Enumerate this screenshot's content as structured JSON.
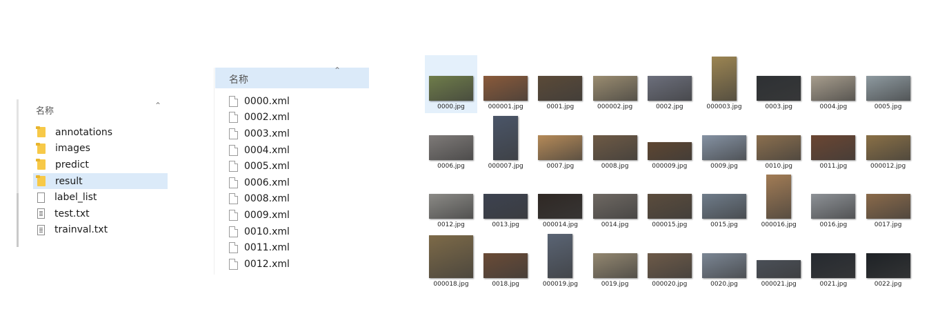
{
  "panel1": {
    "column_header": "名称",
    "items": [
      {
        "type": "folder",
        "label": "annotations"
      },
      {
        "type": "folder",
        "label": "images"
      },
      {
        "type": "folder",
        "label": "predict"
      },
      {
        "type": "folder",
        "label": "result",
        "selected": true
      },
      {
        "type": "file",
        "label": "label_list"
      },
      {
        "type": "txt",
        "label": "test.txt"
      },
      {
        "type": "txt",
        "label": "trainval.txt"
      }
    ]
  },
  "panel2": {
    "column_header": "名称",
    "files": [
      "0000.xml",
      "0002.xml",
      "0003.xml",
      "0004.xml",
      "0005.xml",
      "0006.xml",
      "0008.xml",
      "0009.xml",
      "0010.xml",
      "0011.xml",
      "0012.xml"
    ]
  },
  "panel3": {
    "thumbnails": [
      {
        "name": "0000.jpg",
        "orient": "land",
        "color": "#6f7d4a",
        "selected": true
      },
      {
        "name": "000001.jpg",
        "orient": "land",
        "color": "#8a5a3a"
      },
      {
        "name": "0001.jpg",
        "orient": "land",
        "color": "#5b4a38"
      },
      {
        "name": "000002.jpg",
        "orient": "land",
        "color": "#9a8c70"
      },
      {
        "name": "0002.jpg",
        "orient": "land",
        "color": "#6c6f7c"
      },
      {
        "name": "000003.jpg",
        "orient": "port",
        "color": "#9c8552"
      },
      {
        "name": "0003.jpg",
        "orient": "land",
        "color": "#2e3134"
      },
      {
        "name": "0004.jpg",
        "orient": "land",
        "color": "#a79d8d"
      },
      {
        "name": "0005.jpg",
        "orient": "land",
        "color": "#8e9aa0"
      },
      {
        "name": "0006.jpg",
        "orient": "land",
        "color": "#7e7a78"
      },
      {
        "name": "000007.jpg",
        "orient": "port",
        "color": "#4a5568"
      },
      {
        "name": "0007.jpg",
        "orient": "land",
        "color": "#b58a58"
      },
      {
        "name": "0008.jpg",
        "orient": "land",
        "color": "#6e5a45"
      },
      {
        "name": "000009.jpg",
        "orient": "wide",
        "color": "#5e4631"
      },
      {
        "name": "0009.jpg",
        "orient": "land",
        "color": "#8592a3"
      },
      {
        "name": "0010.jpg",
        "orient": "land",
        "color": "#8b6f4e"
      },
      {
        "name": "0011.jpg",
        "orient": "land",
        "color": "#6b4632"
      },
      {
        "name": "000012.jpg",
        "orient": "land",
        "color": "#8a7046"
      },
      {
        "name": "0012.jpg",
        "orient": "land",
        "color": "#8b8a86"
      },
      {
        "name": "0013.jpg",
        "orient": "land",
        "color": "#3c4250"
      },
      {
        "name": "000014.jpg",
        "orient": "land",
        "color": "#2f2824"
      },
      {
        "name": "0014.jpg",
        "orient": "land",
        "color": "#6e6862"
      },
      {
        "name": "000015.jpg",
        "orient": "land",
        "color": "#5b4c3c"
      },
      {
        "name": "0015.jpg",
        "orient": "land",
        "color": "#6f7c8a"
      },
      {
        "name": "000016.jpg",
        "orient": "port",
        "color": "#a27c55"
      },
      {
        "name": "0016.jpg",
        "orient": "land",
        "color": "#8d9196"
      },
      {
        "name": "0017.jpg",
        "orient": "land",
        "color": "#8a6a4a"
      },
      {
        "name": "000018.jpg",
        "orient": "sq",
        "color": "#7d6a48"
      },
      {
        "name": "0018.jpg",
        "orient": "land",
        "color": "#6a4b36"
      },
      {
        "name": "000019.jpg",
        "orient": "port",
        "color": "#5a6474"
      },
      {
        "name": "0019.jpg",
        "orient": "land",
        "color": "#938770"
      },
      {
        "name": "000020.jpg",
        "orient": "land",
        "color": "#6d5a48"
      },
      {
        "name": "0020.jpg",
        "orient": "land",
        "color": "#7b8694"
      },
      {
        "name": "000021.jpg",
        "orient": "wide",
        "color": "#4a4f57"
      },
      {
        "name": "0021.jpg",
        "orient": "land",
        "color": "#262a30"
      },
      {
        "name": "0022.jpg",
        "orient": "land",
        "color": "#1e2226"
      }
    ]
  }
}
